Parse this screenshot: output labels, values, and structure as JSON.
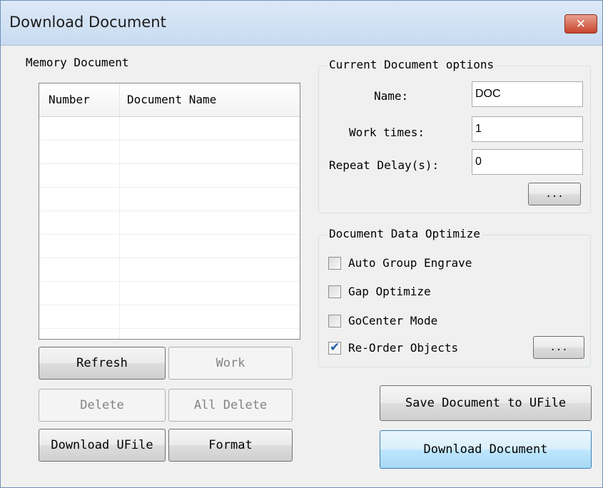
{
  "window": {
    "title": "Download Document",
    "close_glyph": "✕"
  },
  "memory": {
    "group_label": "Memory Document",
    "columns": [
      "Number",
      "Document Name"
    ],
    "rows": [
      "",
      "",
      "",
      "",
      "",
      "",
      "",
      "",
      ""
    ]
  },
  "buttons": {
    "refresh": "Refresh",
    "work": "Work",
    "delete": "Delete",
    "all_delete": "All Delete",
    "download_ufile": "Download UFile",
    "format": "Format",
    "save_to_ufile": "Save Document to UFile",
    "download_document": "Download Document",
    "more_options": "...",
    "more_reorder": "..."
  },
  "current_options": {
    "group_label": "Current Document options",
    "name_label": "Name:",
    "name_value": "DOC",
    "work_times_label": "Work times:",
    "work_times_value": "1",
    "repeat_delay_label": "Repeat Delay(s):",
    "repeat_delay_value": "0"
  },
  "optimize": {
    "group_label": "Document Data Optimize",
    "auto_group_engrave": {
      "label": "Auto Group Engrave",
      "checked": false
    },
    "gap_optimize": {
      "label": "Gap Optimize",
      "checked": false
    },
    "gocenter_mode": {
      "label": "GoCenter Mode",
      "checked": false
    },
    "reorder_objects": {
      "label": "Re-Order Objects",
      "checked": true
    }
  },
  "icons": {
    "close": "close-icon",
    "check": "checkmark-icon"
  },
  "colors": {
    "title_bar": "#c8dbf1",
    "close_button": "#c8442c",
    "primary_button": "#bee6fd"
  }
}
